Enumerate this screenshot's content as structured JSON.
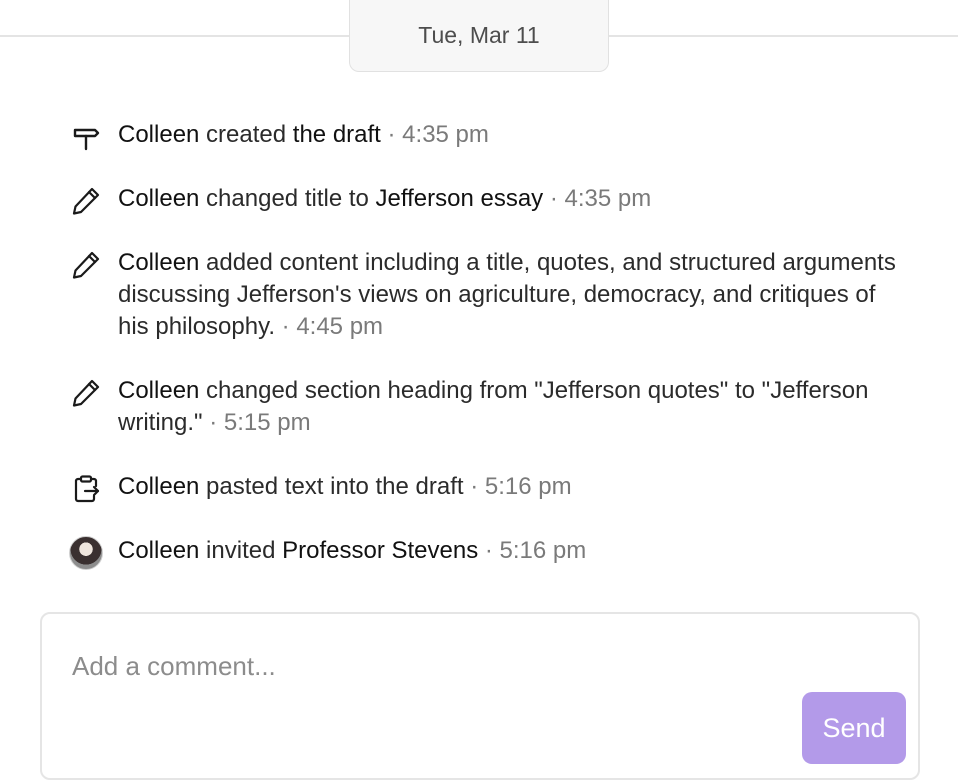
{
  "date_divider": {
    "label": "Tue, Mar 11"
  },
  "activity": [
    {
      "icon": "signpost-icon",
      "actor": "Colleen",
      "action": " created ",
      "object": "the draft",
      "detail": "",
      "time": " · 4:35 pm"
    },
    {
      "icon": "pencil-icon",
      "actor": "Colleen",
      "action": " changed title to ",
      "object": "Jefferson essay",
      "detail": "",
      "time": " · 4:35 pm"
    },
    {
      "icon": "pencil-icon",
      "actor": "Colleen",
      "action": " added content including a title, quotes, and structured arguments discussing Jefferson's views on agriculture, democracy, and critiques of his philosophy.",
      "object": "",
      "detail": "",
      "time": " · 4:45 pm"
    },
    {
      "icon": "pencil-icon",
      "actor": "Colleen",
      "action": " changed section heading from \"Jefferson quotes\" to \"Jefferson writing.\"",
      "object": "",
      "detail": "",
      "time": " · 5:15 pm"
    },
    {
      "icon": "clipboard-paste-icon",
      "actor": "Colleen",
      "action": " pasted text into the draft",
      "object": "",
      "detail": "",
      "time": " · 5:16 pm"
    },
    {
      "icon": "avatar",
      "actor": "Colleen",
      "action": " invited ",
      "object": "Professor Stevens",
      "detail": "",
      "time": " · 5:16 pm"
    }
  ],
  "comment": {
    "placeholder": "Add a comment...",
    "value": "",
    "send_label": "Send"
  },
  "colors": {
    "send_button": "#b39ae9",
    "meta_text": "#7a7a7a",
    "divider": "#e4e4e4"
  }
}
